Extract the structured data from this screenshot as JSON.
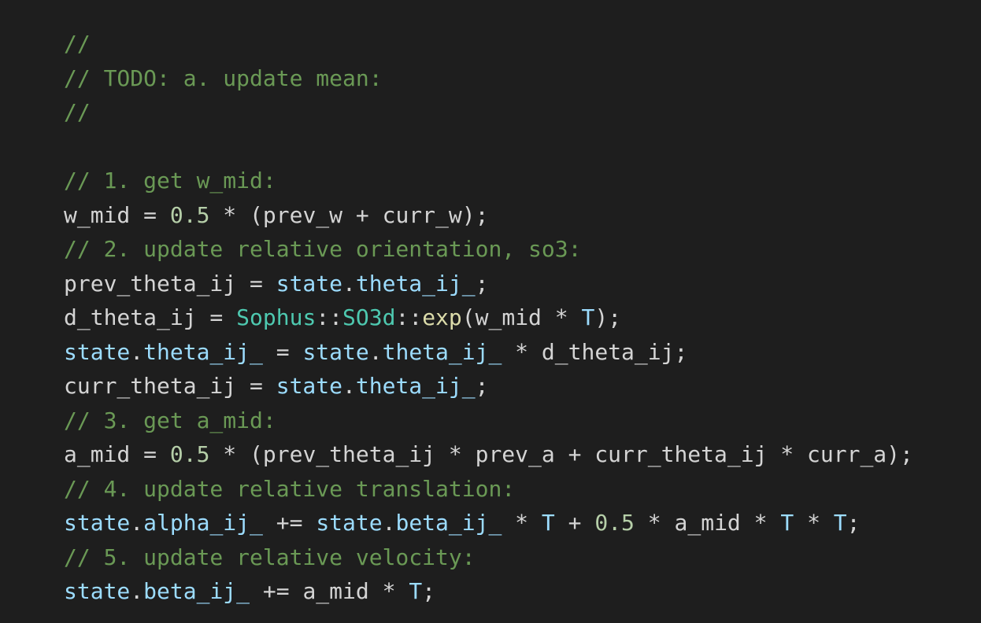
{
  "editor": {
    "background": "#1e1e1e",
    "token_colors": {
      "comment": "#6a9955",
      "variable": "#9cdcfe",
      "number": "#b5cea8",
      "type": "#4ec9b0",
      "function": "#dcdcaa",
      "plain": "#d4d4d4"
    },
    "lines": [
      [
        {
          "t": "c",
          "v": "//"
        }
      ],
      [
        {
          "t": "c",
          "v": "// TODO: a. update mean:"
        }
      ],
      [
        {
          "t": "c",
          "v": "//"
        }
      ],
      [],
      [
        {
          "t": "c",
          "v": "// 1. get w_mid:"
        }
      ],
      [
        {
          "t": "p",
          "v": "w_mid = "
        },
        {
          "t": "n",
          "v": "0.5"
        },
        {
          "t": "p",
          "v": " * (prev_w + curr_w);"
        }
      ],
      [
        {
          "t": "c",
          "v": "// 2. update relative orientation, so3:"
        }
      ],
      [
        {
          "t": "p",
          "v": "prev_theta_ij = "
        },
        {
          "t": "v",
          "v": "state"
        },
        {
          "t": "p",
          "v": "."
        },
        {
          "t": "v",
          "v": "theta_ij_"
        },
        {
          "t": "p",
          "v": ";"
        }
      ],
      [
        {
          "t": "p",
          "v": "d_theta_ij = "
        },
        {
          "t": "ty",
          "v": "Sophus"
        },
        {
          "t": "p",
          "v": "::"
        },
        {
          "t": "ty",
          "v": "SO3d"
        },
        {
          "t": "p",
          "v": "::"
        },
        {
          "t": "f",
          "v": "exp"
        },
        {
          "t": "p",
          "v": "(w_mid * "
        },
        {
          "t": "v",
          "v": "T"
        },
        {
          "t": "p",
          "v": ");"
        }
      ],
      [
        {
          "t": "v",
          "v": "state"
        },
        {
          "t": "p",
          "v": "."
        },
        {
          "t": "v",
          "v": "theta_ij_"
        },
        {
          "t": "p",
          "v": " = "
        },
        {
          "t": "v",
          "v": "state"
        },
        {
          "t": "p",
          "v": "."
        },
        {
          "t": "v",
          "v": "theta_ij_"
        },
        {
          "t": "p",
          "v": " * d_theta_ij;"
        }
      ],
      [
        {
          "t": "p",
          "v": "curr_theta_ij = "
        },
        {
          "t": "v",
          "v": "state"
        },
        {
          "t": "p",
          "v": "."
        },
        {
          "t": "v",
          "v": "theta_ij_"
        },
        {
          "t": "p",
          "v": ";"
        }
      ],
      [
        {
          "t": "c",
          "v": "// 3. get a_mid:"
        }
      ],
      [
        {
          "t": "p",
          "v": "a_mid = "
        },
        {
          "t": "n",
          "v": "0.5"
        },
        {
          "t": "p",
          "v": " * (prev_theta_ij * prev_a + curr_theta_ij * curr_a);"
        }
      ],
      [
        {
          "t": "c",
          "v": "// 4. update relative translation:"
        }
      ],
      [
        {
          "t": "v",
          "v": "state"
        },
        {
          "t": "p",
          "v": "."
        },
        {
          "t": "v",
          "v": "alpha_ij_"
        },
        {
          "t": "p",
          "v": " += "
        },
        {
          "t": "v",
          "v": "state"
        },
        {
          "t": "p",
          "v": "."
        },
        {
          "t": "v",
          "v": "beta_ij_"
        },
        {
          "t": "p",
          "v": " * "
        },
        {
          "t": "v",
          "v": "T"
        },
        {
          "t": "p",
          "v": " + "
        },
        {
          "t": "n",
          "v": "0.5"
        },
        {
          "t": "p",
          "v": " * a_mid * "
        },
        {
          "t": "v",
          "v": "T"
        },
        {
          "t": "p",
          "v": " * "
        },
        {
          "t": "v",
          "v": "T"
        },
        {
          "t": "p",
          "v": ";"
        }
      ],
      [
        {
          "t": "c",
          "v": "// 5. update relative velocity:"
        }
      ],
      [
        {
          "t": "v",
          "v": "state"
        },
        {
          "t": "p",
          "v": "."
        },
        {
          "t": "v",
          "v": "beta_ij_"
        },
        {
          "t": "p",
          "v": " += a_mid * "
        },
        {
          "t": "v",
          "v": "T"
        },
        {
          "t": "p",
          "v": ";"
        }
      ]
    ]
  }
}
